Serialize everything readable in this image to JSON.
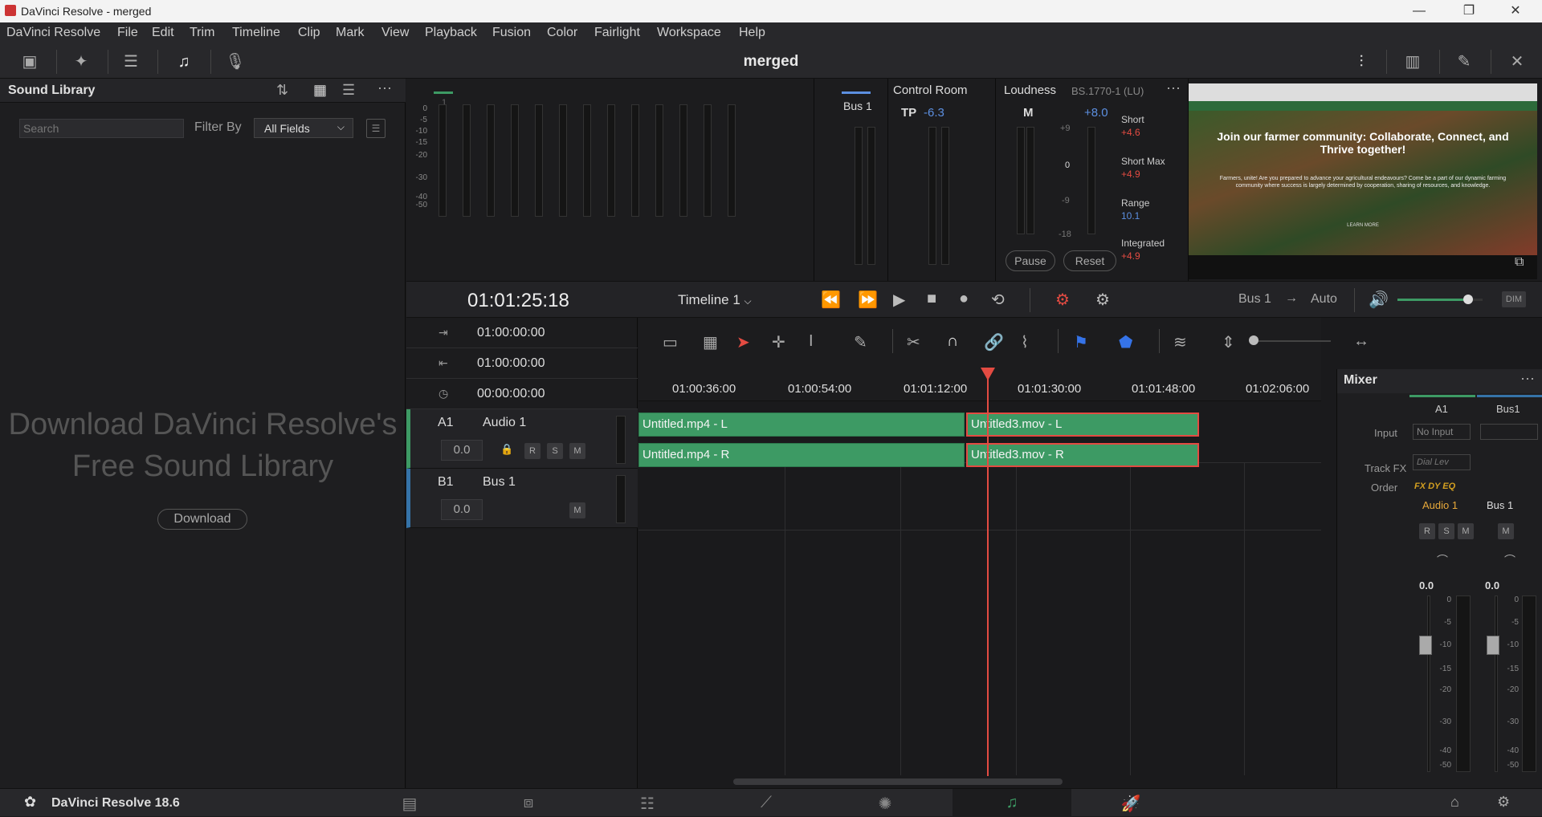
{
  "window": {
    "title": "DaVinci Resolve - merged",
    "min": "—",
    "max": "❐",
    "close": "✕"
  },
  "menu": [
    "DaVinci Resolve",
    "File",
    "Edit",
    "Trim",
    "Timeline",
    "Clip",
    "Mark",
    "View",
    "Playback",
    "Fusion",
    "Color",
    "Fairlight",
    "Workspace",
    "Help"
  ],
  "project": {
    "title": "merged"
  },
  "sound_library": {
    "title": "Sound Library",
    "search_placeholder": "Search",
    "filter_label": "Filter By",
    "filter_value": "All Fields",
    "download_text": "Download DaVinci Resolve's Free Sound Library",
    "download_button": "Download"
  },
  "meters": {
    "track_label": "1",
    "scale": [
      "0",
      "-5",
      "-10",
      "-15",
      "-20",
      "-30",
      "-40",
      "-50"
    ],
    "bus_label": "Bus 1",
    "control_room": {
      "title": "Control Room",
      "tp_label": "TP",
      "tp_value": "-6.3"
    },
    "loudness": {
      "title": "Loudness",
      "standard": "BS.1770-1 (LU)",
      "m_label": "M",
      "m_value": "+8.0",
      "scale": [
        "+9",
        "0",
        "-9",
        "-18"
      ],
      "short_label": "Short",
      "short_value": "+4.6",
      "short_max_label": "Short Max",
      "short_max_value": "+4.9",
      "range_label": "Range",
      "range_value": "10.1",
      "integrated_label": "Integrated",
      "integrated_value": "+4.9",
      "pause": "Pause",
      "reset": "Reset"
    }
  },
  "preview": {
    "headline": "Join our farmer community: Collaborate, Connect, and Thrive together!",
    "body": "Farmers, unite! Are you prepared to advance your agricultural endeavours? Come be a part of our dynamic farming community where success is largely determined by cooperation, sharing of resources, and knowledge.",
    "cta": "LEARN MORE"
  },
  "transport": {
    "timecode": "01:01:25:18",
    "timeline_name": "Timeline 1",
    "bus_out": "Bus 1",
    "arrow": "→",
    "auto": "Auto",
    "dim": "DIM",
    "volume_level": 0.83
  },
  "timecodes": [
    {
      "icon": "⇥",
      "value": "01:00:00:00"
    },
    {
      "icon": "⇤",
      "value": "01:00:00:00"
    },
    {
      "icon": "◷",
      "value": "00:00:00:00"
    }
  ],
  "tracks": [
    {
      "id": "A1",
      "name": "Audio 1",
      "volume": "0.0",
      "r": "R",
      "s": "S",
      "m": "M"
    },
    {
      "id": "B1",
      "name": "Bus 1",
      "volume": "0.0",
      "m": "M"
    }
  ],
  "ruler": [
    "01:00:36:00",
    "01:00:54:00",
    "01:01:12:00",
    "01:01:30:00",
    "01:01:48:00",
    "01:02:06:00"
  ],
  "clips": [
    {
      "name": "Untitled.mp4 - L"
    },
    {
      "name": "Untitled.mp4 - R"
    },
    {
      "name": "Untitled3.mov - L"
    },
    {
      "name": "Untitled3.mov - R"
    }
  ],
  "mixer": {
    "title": "Mixer",
    "col_a": "A1",
    "col_b": "Bus1",
    "input_label": "Input",
    "input_value": "No Input",
    "trackfx_label": "Track FX",
    "trackfx_value": "Dial Lev",
    "order_label": "Order",
    "order_value": "FX DY EQ",
    "ch_a": "Audio 1",
    "ch_b": "Bus 1",
    "ch_a_vol": "0.0",
    "ch_b_vol": "0.0",
    "r": "R",
    "s": "S",
    "m": "M",
    "scale": [
      "0",
      "-5",
      "-10",
      "-15",
      "-20",
      "-30",
      "-40",
      "-50"
    ]
  },
  "footer": {
    "app_name": "DaVinci Resolve 18.6",
    "pages": [
      "media",
      "cut",
      "edit",
      "fusion",
      "color",
      "fairlight",
      "deliver"
    ],
    "active_page": "fairlight"
  },
  "colors": {
    "accent_green": "#3d9a64",
    "playhead": "#e34b42",
    "loudness_red": "#e34b42",
    "loudness_blue": "#5c8fe0"
  }
}
